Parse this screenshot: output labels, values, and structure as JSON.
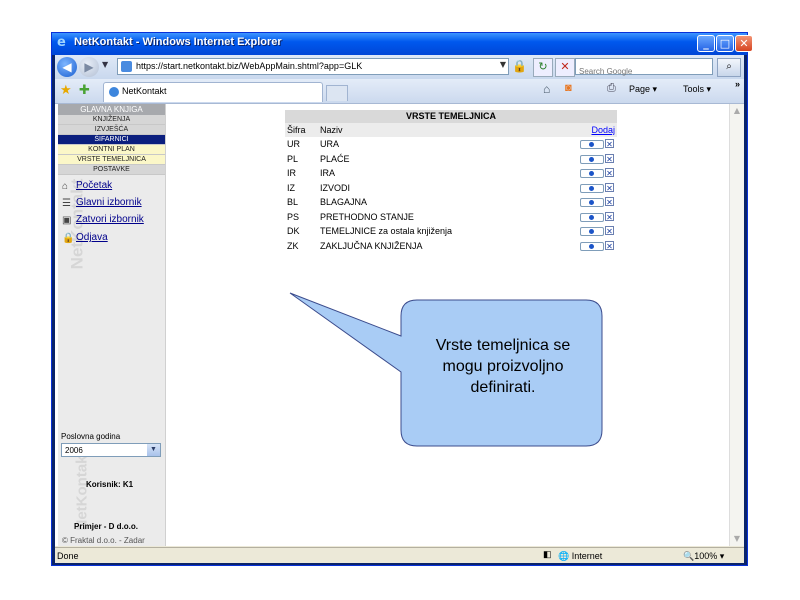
{
  "window": {
    "title": "NetKontakt - Windows Internet Explorer",
    "minimize": "_",
    "maximize": "□",
    "close": "✕"
  },
  "address_bar": {
    "url": "https://start.netkontakt.biz/WebAppMain.shtml?app=GLK",
    "search_placeholder": "Search Google"
  },
  "tabs": [
    {
      "label": "NetKontakt"
    }
  ],
  "command_bar": {
    "page": "Page ▾",
    "tools": "Tools ▾",
    "more": "»"
  },
  "sidebar": {
    "menu_header": "GLAVNA KNJIGA",
    "menu": [
      {
        "label": "KNJIŽENJA"
      },
      {
        "label": "IZVJEŠĆA"
      },
      {
        "label": "ŠIFARNICI"
      },
      {
        "label": "KONTNI PLAN"
      },
      {
        "label": "VRSTE TEMELJNICA"
      },
      {
        "label": "POSTAVKE"
      }
    ],
    "links": [
      {
        "label": "Početak"
      },
      {
        "label": "Glavni izbornik"
      },
      {
        "label": "Zatvori izbornik"
      },
      {
        "label": "Odjava"
      }
    ],
    "watermark": "NetKontakt",
    "year_label": "Poslovna godina",
    "year_value": "2006",
    "user_label": "Korisnik:",
    "user_value": "K1",
    "company": "Primjer - D d.o.o.",
    "copyright": "© Fraktal d.o.o. - Zadar"
  },
  "table": {
    "title": "VRSTE TEMELJNICA",
    "col_code": "Šifra",
    "col_name": "Naziv",
    "add_link": "Dodaj",
    "rows": [
      {
        "code": "UR",
        "name": "URA"
      },
      {
        "code": "PL",
        "name": "PLAĆE"
      },
      {
        "code": "IR",
        "name": "IRA"
      },
      {
        "code": "IZ",
        "name": "IZVODI"
      },
      {
        "code": "BL",
        "name": "BLAGAJNA"
      },
      {
        "code": "PS",
        "name": "PRETHODNO STANJE"
      },
      {
        "code": "DK",
        "name": "TEMELJNICE za ostala knjiženja"
      },
      {
        "code": "ZK",
        "name": "ZAKLJUČNA KNJIŽENJA"
      }
    ]
  },
  "callout": {
    "line1": "Vrste temeljnica se",
    "line2": "mogu proizvoljno",
    "line3": "definirati.",
    "fill": "#a9ccf5",
    "stroke": "#3b4b8c"
  },
  "status_bar": {
    "text": "Done",
    "zone": "Internet",
    "zoom": "100%"
  }
}
